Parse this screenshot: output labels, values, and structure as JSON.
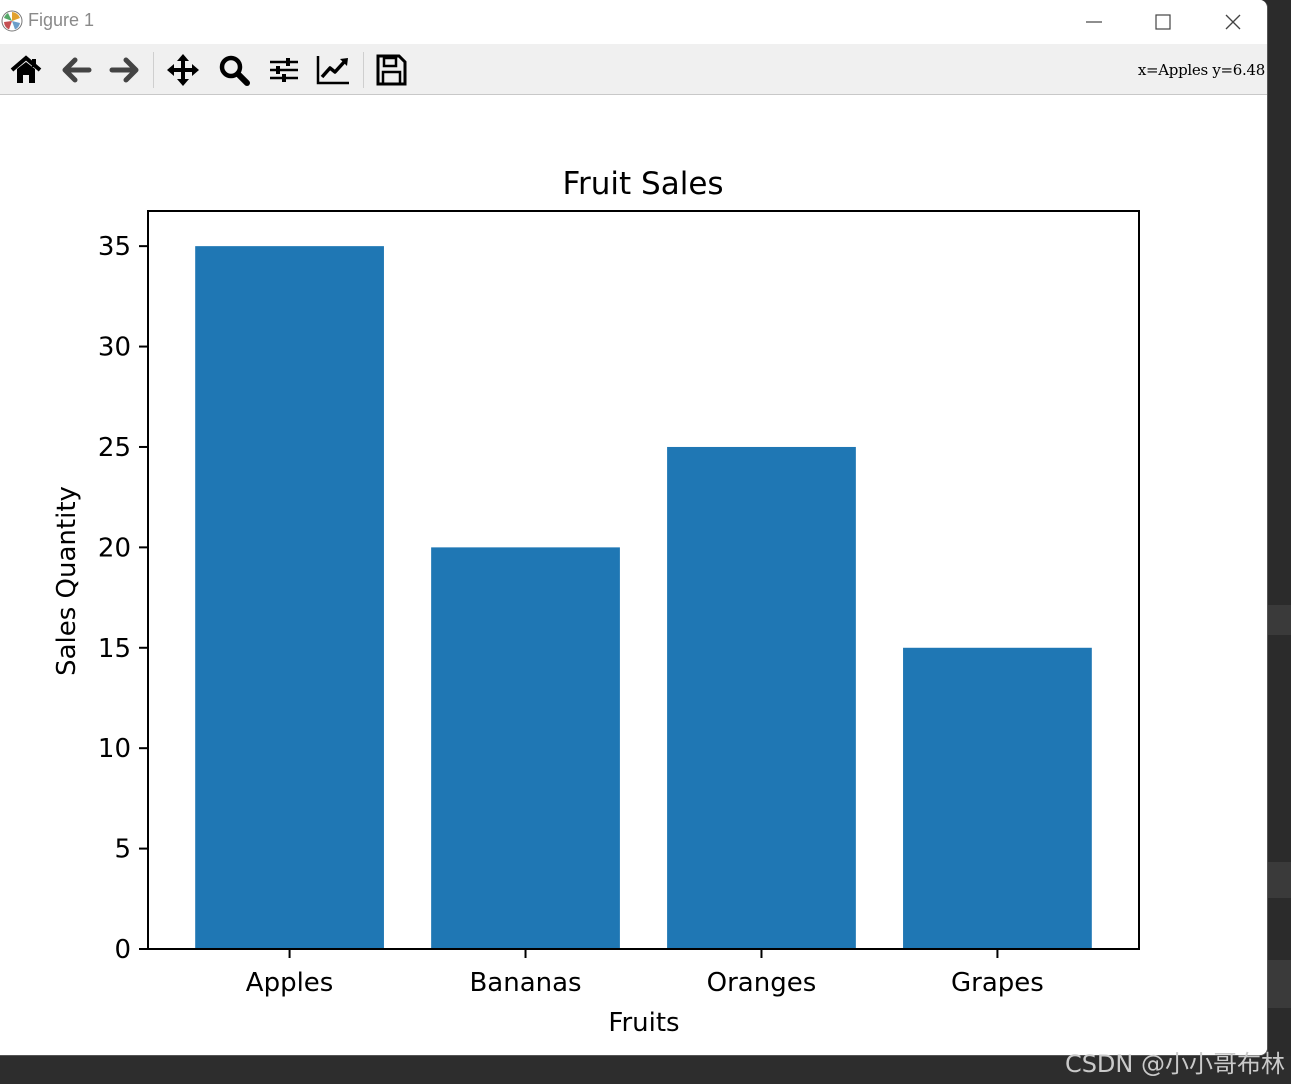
{
  "window": {
    "title": "Figure 1",
    "controls": {
      "minimize": "minimize",
      "maximize": "maximize",
      "close": "close"
    }
  },
  "toolbar": {
    "tools": [
      {
        "name": "home",
        "icon": "home-icon"
      },
      {
        "name": "back",
        "icon": "back-arrow-icon"
      },
      {
        "name": "forward",
        "icon": "forward-arrow-icon"
      },
      {
        "name": "pan",
        "icon": "move-icon"
      },
      {
        "name": "zoom",
        "icon": "magnifier-icon"
      },
      {
        "name": "subplots",
        "icon": "sliders-icon"
      },
      {
        "name": "edit-axes",
        "icon": "line-chart-icon"
      },
      {
        "name": "save",
        "icon": "floppy-disk-icon"
      }
    ],
    "coords": "x=Apples y=6.48"
  },
  "chart_data": {
    "type": "bar",
    "title": "Fruit Sales",
    "xlabel": "Fruits",
    "ylabel": "Sales Quantity",
    "categories": [
      "Apples",
      "Bananas",
      "Oranges",
      "Grapes"
    ],
    "values": [
      35,
      20,
      25,
      15
    ],
    "ylim": [
      0,
      36.75
    ],
    "yticks": [
      0,
      5,
      10,
      15,
      20,
      25,
      30,
      35
    ],
    "bar_color": "#1f77b4",
    "grid": false
  },
  "watermark": "CSDN @小小哥布林"
}
